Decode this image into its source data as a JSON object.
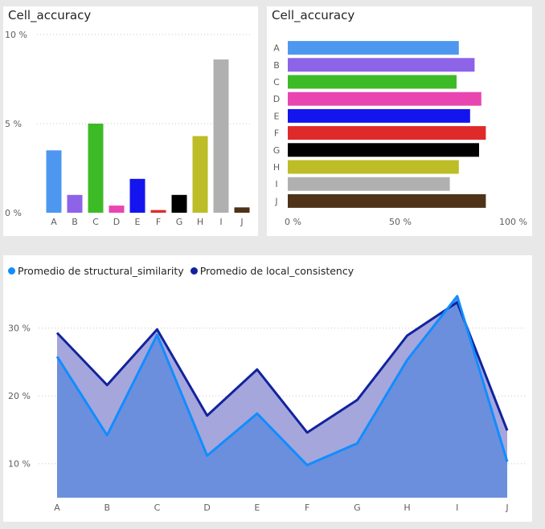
{
  "charts": {
    "column": {
      "title": "Cell_accuracy"
    },
    "horizontal": {
      "title": "Cell_accuracy"
    },
    "area": {
      "legend": [
        {
          "label": "Promedio de structural_similarity",
          "color": "#118dff"
        },
        {
          "label": "Promedio de local_consistency",
          "color": "#12239e"
        }
      ]
    }
  },
  "chart_data": [
    {
      "type": "bar",
      "orientation": "vertical",
      "title": "Cell_accuracy",
      "categories": [
        "A",
        "B",
        "C",
        "D",
        "E",
        "F",
        "G",
        "H",
        "I",
        "J"
      ],
      "values": [
        3.5,
        1.0,
        5.0,
        0.4,
        1.9,
        0.15,
        1.0,
        4.3,
        8.6,
        0.3
      ],
      "colors": [
        "#4e97f0",
        "#8d63e8",
        "#3dbb27",
        "#e945b0",
        "#1414ef",
        "#e02a2a",
        "#000000",
        "#bdbd27",
        "#b0b0b0",
        "#4e3318"
      ],
      "yticks": [
        "0 %",
        "5 %",
        "10 %"
      ],
      "ylim": [
        0,
        10
      ],
      "unit": "%",
      "grid": true
    },
    {
      "type": "bar",
      "orientation": "horizontal",
      "title": "Cell_accuracy",
      "categories": [
        "A",
        "B",
        "C",
        "D",
        "E",
        "F",
        "G",
        "H",
        "I",
        "J"
      ],
      "values": [
        76,
        83,
        75,
        86,
        81,
        88,
        85,
        76,
        72,
        88
      ],
      "colors": [
        "#4e97f0",
        "#8d63e8",
        "#3dbb27",
        "#e945b0",
        "#1414ef",
        "#e02a2a",
        "#000000",
        "#bdbd27",
        "#b0b0b0",
        "#4e3318"
      ],
      "xticks": [
        "0 %",
        "50 %",
        "100 %"
      ],
      "xlim": [
        0,
        100
      ],
      "unit": "%"
    },
    {
      "type": "area",
      "categories": [
        "A",
        "B",
        "C",
        "D",
        "E",
        "F",
        "G",
        "H",
        "I",
        "J"
      ],
      "series": [
        {
          "name": "Promedio de structural_similarity",
          "color": "#118dff",
          "values": [
            25.8,
            14.2,
            29.0,
            11.2,
            17.4,
            9.8,
            13.0,
            25.3,
            34.7,
            10.3
          ]
        },
        {
          "name": "Promedio de local_consistency",
          "color": "#12239e",
          "values": [
            29.3,
            21.6,
            29.8,
            17.1,
            23.9,
            14.6,
            19.4,
            28.9,
            33.8,
            14.9
          ]
        }
      ],
      "yticks": [
        "10 %",
        "20 %",
        "30 %"
      ],
      "ylim": [
        5,
        36
      ],
      "unit": "%",
      "legend": "top-left",
      "grid": true
    }
  ]
}
